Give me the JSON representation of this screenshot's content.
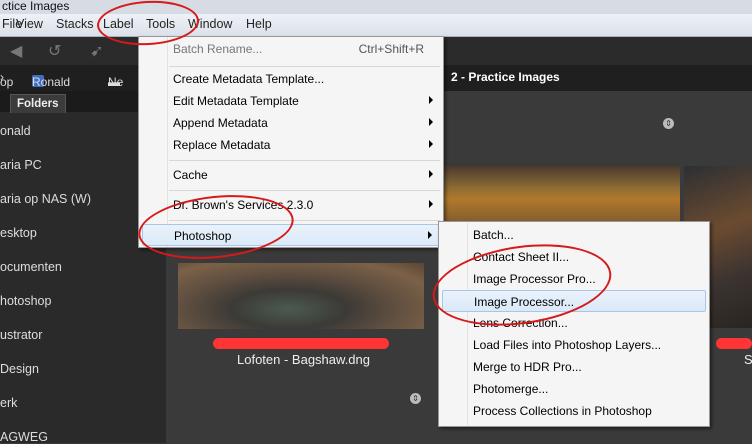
{
  "window": {
    "title": "ctice Images"
  },
  "menubar": {
    "items": [
      "File",
      "View",
      "Stacks",
      "Label",
      "Tools",
      "Window",
      "Help"
    ]
  },
  "pathbar": {
    "crumbs": [
      "op",
      "Ronald",
      "Ne"
    ],
    "title": "2 - Practice Images"
  },
  "leftpanel": {
    "tab": "Folders",
    "folders": [
      "onald",
      "aria PC",
      "aria op NAS (W)",
      "esktop",
      "ocumenten",
      "hotoshop",
      "ustrator",
      "Design",
      "erk",
      "AGWEG"
    ]
  },
  "content": {
    "thumb1_name": "Lofoten - Bagshaw.dng",
    "thumb1_rating_icon": "star-icon",
    "right_partial_label": "S"
  },
  "tools_menu": {
    "items": [
      {
        "label": "Batch Rename...",
        "shortcut": "Ctrl+Shift+R",
        "disabled": true,
        "submenu": false
      },
      {
        "label": "Create Metadata Template...",
        "shortcut": "",
        "submenu": false
      },
      {
        "label": "Edit Metadata Template",
        "shortcut": "",
        "submenu": true
      },
      {
        "label": "Append Metadata",
        "shortcut": "",
        "submenu": true
      },
      {
        "label": "Replace Metadata",
        "shortcut": "",
        "submenu": true
      },
      {
        "label": "Cache",
        "shortcut": "",
        "submenu": true
      },
      {
        "label": "Dr. Brown's Services 2.3.0",
        "shortcut": "",
        "submenu": true
      },
      {
        "label": "Photoshop",
        "shortcut": "",
        "submenu": true,
        "highlighted": true
      }
    ]
  },
  "photoshop_menu": {
    "items": [
      {
        "label": "Batch..."
      },
      {
        "label": "Contact Sheet II..."
      },
      {
        "label": "Image Processor Pro..."
      },
      {
        "label": "Image Processor...",
        "highlighted": true
      },
      {
        "label": "Lens Correction..."
      },
      {
        "label": "Load Files into Photoshop Layers..."
      },
      {
        "label": "Merge to HDR Pro..."
      },
      {
        "label": "Photomerge..."
      },
      {
        "label": "Process Collections in Photoshop"
      }
    ]
  },
  "colors": {
    "annotation_ring": "#d61a1a",
    "rating_bar": "#ff3535",
    "menu_highlight": "#dbe9f8"
  }
}
